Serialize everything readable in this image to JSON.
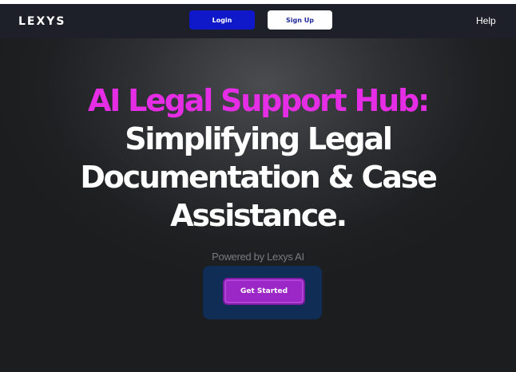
{
  "header": {
    "logo": "LEXYS",
    "login_label": "Login",
    "signup_label": "Sign Up",
    "help_label": "Help"
  },
  "hero": {
    "title_accent": "AI Legal Support Hub:",
    "title_line_1": "Simplifying Legal",
    "title_line_2": "Documentation & Case",
    "title_line_3": "Assistance.",
    "powered_by": "Powered by Lexys AI",
    "cta_label": "Get Started"
  },
  "colors": {
    "accent": "#e62de6",
    "login_button": "#1019c9",
    "cta_button": "#9c27c7",
    "cta_frame": "#0f2d55",
    "background": "#2a2c30"
  }
}
